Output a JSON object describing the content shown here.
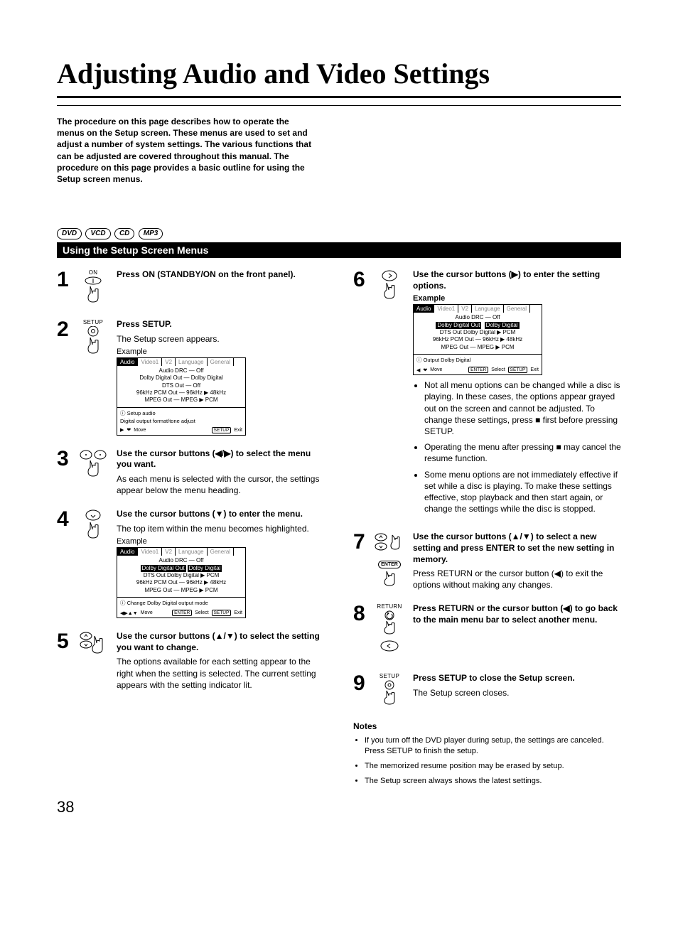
{
  "title": "Adjusting Audio and Video Settings",
  "intro": "The procedure on this page describes how to operate the menus on the Setup screen. These menus are used to set and adjust a number of system settings. The various functions that can be adjusted are covered throughout this manual. The procedure on this page provides a basic outline for using the Setup screen menus.",
  "badges": {
    "dvd": "DVD",
    "vcd": "VCD",
    "cd": "CD",
    "mp3": "MP3"
  },
  "section_heading": "Using the Setup Screen Menus",
  "s1": {
    "label": "ON",
    "head": "Press ON (STANDBY/ON on the front panel)."
  },
  "s2": {
    "label": "SETUP",
    "head": "Press SETUP.",
    "text": "The Setup screen appears.",
    "example": "Example",
    "tabs": {
      "audio": "Audio",
      "v1": "Video1",
      "v2": "V2",
      "lang": "Language",
      "gen": "General"
    },
    "l1": "Audio DRC — Off",
    "l2": "Dolby Digital Out — Dolby Digital",
    "l3": "DTS Out — Off",
    "l4": "96kHz PCM Out — 96kHz ▶ 48kHz",
    "l5": "MPEG Out — MPEG ▶ PCM",
    "info1": "ⓘ Setup audio",
    "info2": "Digital output format/tone adjust",
    "foot_move": "Move",
    "foot_setup": "SETUP",
    "foot_exit": "Exit"
  },
  "s3": {
    "head": "Use the cursor buttons (◀/▶) to select the menu you want.",
    "text": "As each menu is selected with the cursor, the settings appear below the menu heading."
  },
  "s4": {
    "head": "Use the cursor buttons (▼) to enter the menu.",
    "text": "The top item within the menu becomes highlighted.",
    "example": "Example",
    "l1": "Audio DRC — Off",
    "l2a": "Dolby Digital Out",
    "l2b": "Dolby Digital",
    "l3": "DTS Out    Dolby Digital ▶ PCM",
    "l4": "96kHz PCM Out — 96kHz ▶ 48kHz",
    "l5": "MPEG Out — MPEG ▶ PCM",
    "info": "ⓘ Change Dolby Digital output mode",
    "foot_move": "Move",
    "foot_enter": "ENTER",
    "foot_select": "Select",
    "foot_setup": "SETUP",
    "foot_exit": "Exit"
  },
  "s5": {
    "head": "Use the cursor buttons (▲/▼) to select the setting you want to change.",
    "text": "The options available for each setting appear to the right when the setting is selected. The current setting appears with the setting indicator lit."
  },
  "s6": {
    "head": "Use the cursor buttons (▶)  to enter the setting options.",
    "example": "Example",
    "l1": "Audio DRC — Off",
    "l2a": "Dolby Digital Out",
    "l2b": "Dolby Digital",
    "l3": "DTS Out    Dolby Digital ▶ PCM",
    "l4": "96kHz PCM Out — 96kHz ▶ 48kHz",
    "l5": "MPEG Out — MPEG ▶ PCM",
    "info": "ⓘ Output Dolby Digital",
    "foot_move": "Move",
    "foot_enter": "ENTER",
    "foot_select": "Select",
    "foot_setup": "SETUP",
    "foot_exit": "Exit",
    "b1": "Not all menu options can be changed while a disc is playing. In these cases, the options appear grayed out on the screen and cannot be adjusted. To change these settings, press ■ first before pressing SETUP.",
    "b2": "Operating the menu after pressing ■ may cancel the resume function.",
    "b3": "Some menu options are not immediately effective if set while a disc is playing. To make these settings effective, stop playback and then start again, or change the settings while the disc is stopped."
  },
  "s7": {
    "enter_label": "ENTER",
    "head": "Use the cursor buttons (▲/▼) to select a new  setting and press ENTER to set the new setting in memory.",
    "text": "Press RETURN or the cursor button (◀) to exit the options without making any changes."
  },
  "s8": {
    "label": "RETURN",
    "head": "Press RETURN or the cursor button (◀) to go back to the main menu bar to select another menu."
  },
  "s9": {
    "label": "SETUP",
    "head": "Press SETUP to close the Setup screen.",
    "text": "The Setup screen closes."
  },
  "notes": {
    "head": "Notes",
    "n1": "If you  turn off the DVD player during setup, the settings are canceled. Press SETUP to finish the setup.",
    "n2": "The memorized resume position may be erased by setup.",
    "n3": "The Setup screen always shows the latest settings."
  },
  "page_number": "38"
}
